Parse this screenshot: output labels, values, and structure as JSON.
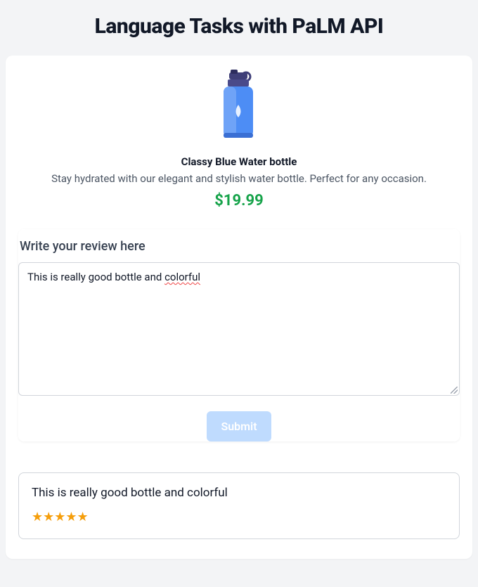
{
  "page": {
    "title": "Language Tasks with PaLM API"
  },
  "product": {
    "name": "Classy Blue Water bottle",
    "description": "Stay hydrated with our elegant and stylish water bottle. Perfect for any occasion.",
    "price": "$19.99"
  },
  "review": {
    "label": "Write your review here",
    "input_prefix": "This is really good bottle and ",
    "input_spellword": "colorful",
    "submit_label": "Submit"
  },
  "result": {
    "text": "This is really good bottle and colorful",
    "stars": "★★★★★",
    "rating": 5
  }
}
